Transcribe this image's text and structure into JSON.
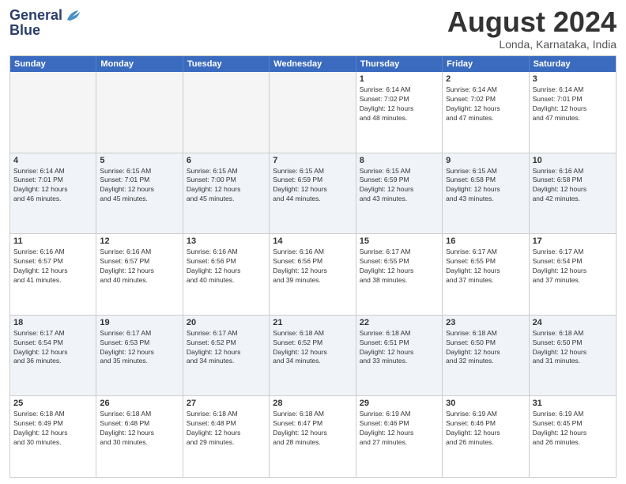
{
  "header": {
    "logo_line1": "General",
    "logo_line2": "Blue",
    "month_year": "August 2024",
    "location": "Londa, Karnataka, India"
  },
  "weekdays": [
    "Sunday",
    "Monday",
    "Tuesday",
    "Wednesday",
    "Thursday",
    "Friday",
    "Saturday"
  ],
  "weeks": [
    [
      {
        "day": "",
        "info": "",
        "empty": true
      },
      {
        "day": "",
        "info": "",
        "empty": true
      },
      {
        "day": "",
        "info": "",
        "empty": true
      },
      {
        "day": "",
        "info": "",
        "empty": true
      },
      {
        "day": "1",
        "info": "Sunrise: 6:14 AM\nSunset: 7:02 PM\nDaylight: 12 hours\nand 48 minutes."
      },
      {
        "day": "2",
        "info": "Sunrise: 6:14 AM\nSunset: 7:02 PM\nDaylight: 12 hours\nand 47 minutes."
      },
      {
        "day": "3",
        "info": "Sunrise: 6:14 AM\nSunset: 7:01 PM\nDaylight: 12 hours\nand 47 minutes."
      }
    ],
    [
      {
        "day": "4",
        "info": "Sunrise: 6:14 AM\nSunset: 7:01 PM\nDaylight: 12 hours\nand 46 minutes."
      },
      {
        "day": "5",
        "info": "Sunrise: 6:15 AM\nSunset: 7:01 PM\nDaylight: 12 hours\nand 45 minutes."
      },
      {
        "day": "6",
        "info": "Sunrise: 6:15 AM\nSunset: 7:00 PM\nDaylight: 12 hours\nand 45 minutes."
      },
      {
        "day": "7",
        "info": "Sunrise: 6:15 AM\nSunset: 6:59 PM\nDaylight: 12 hours\nand 44 minutes."
      },
      {
        "day": "8",
        "info": "Sunrise: 6:15 AM\nSunset: 6:59 PM\nDaylight: 12 hours\nand 43 minutes."
      },
      {
        "day": "9",
        "info": "Sunrise: 6:15 AM\nSunset: 6:58 PM\nDaylight: 12 hours\nand 43 minutes."
      },
      {
        "day": "10",
        "info": "Sunrise: 6:16 AM\nSunset: 6:58 PM\nDaylight: 12 hours\nand 42 minutes."
      }
    ],
    [
      {
        "day": "11",
        "info": "Sunrise: 6:16 AM\nSunset: 6:57 PM\nDaylight: 12 hours\nand 41 minutes."
      },
      {
        "day": "12",
        "info": "Sunrise: 6:16 AM\nSunset: 6:57 PM\nDaylight: 12 hours\nand 40 minutes."
      },
      {
        "day": "13",
        "info": "Sunrise: 6:16 AM\nSunset: 6:56 PM\nDaylight: 12 hours\nand 40 minutes."
      },
      {
        "day": "14",
        "info": "Sunrise: 6:16 AM\nSunset: 6:56 PM\nDaylight: 12 hours\nand 39 minutes."
      },
      {
        "day": "15",
        "info": "Sunrise: 6:17 AM\nSunset: 6:55 PM\nDaylight: 12 hours\nand 38 minutes."
      },
      {
        "day": "16",
        "info": "Sunrise: 6:17 AM\nSunset: 6:55 PM\nDaylight: 12 hours\nand 37 minutes."
      },
      {
        "day": "17",
        "info": "Sunrise: 6:17 AM\nSunset: 6:54 PM\nDaylight: 12 hours\nand 37 minutes."
      }
    ],
    [
      {
        "day": "18",
        "info": "Sunrise: 6:17 AM\nSunset: 6:54 PM\nDaylight: 12 hours\nand 36 minutes."
      },
      {
        "day": "19",
        "info": "Sunrise: 6:17 AM\nSunset: 6:53 PM\nDaylight: 12 hours\nand 35 minutes."
      },
      {
        "day": "20",
        "info": "Sunrise: 6:17 AM\nSunset: 6:52 PM\nDaylight: 12 hours\nand 34 minutes."
      },
      {
        "day": "21",
        "info": "Sunrise: 6:18 AM\nSunset: 6:52 PM\nDaylight: 12 hours\nand 34 minutes."
      },
      {
        "day": "22",
        "info": "Sunrise: 6:18 AM\nSunset: 6:51 PM\nDaylight: 12 hours\nand 33 minutes."
      },
      {
        "day": "23",
        "info": "Sunrise: 6:18 AM\nSunset: 6:50 PM\nDaylight: 12 hours\nand 32 minutes."
      },
      {
        "day": "24",
        "info": "Sunrise: 6:18 AM\nSunset: 6:50 PM\nDaylight: 12 hours\nand 31 minutes."
      }
    ],
    [
      {
        "day": "25",
        "info": "Sunrise: 6:18 AM\nSunset: 6:49 PM\nDaylight: 12 hours\nand 30 minutes."
      },
      {
        "day": "26",
        "info": "Sunrise: 6:18 AM\nSunset: 6:48 PM\nDaylight: 12 hours\nand 30 minutes."
      },
      {
        "day": "27",
        "info": "Sunrise: 6:18 AM\nSunset: 6:48 PM\nDaylight: 12 hours\nand 29 minutes."
      },
      {
        "day": "28",
        "info": "Sunrise: 6:18 AM\nSunset: 6:47 PM\nDaylight: 12 hours\nand 28 minutes."
      },
      {
        "day": "29",
        "info": "Sunrise: 6:19 AM\nSunset: 6:46 PM\nDaylight: 12 hours\nand 27 minutes."
      },
      {
        "day": "30",
        "info": "Sunrise: 6:19 AM\nSunset: 6:46 PM\nDaylight: 12 hours\nand 26 minutes."
      },
      {
        "day": "31",
        "info": "Sunrise: 6:19 AM\nSunset: 6:45 PM\nDaylight: 12 hours\nand 26 minutes."
      }
    ]
  ]
}
